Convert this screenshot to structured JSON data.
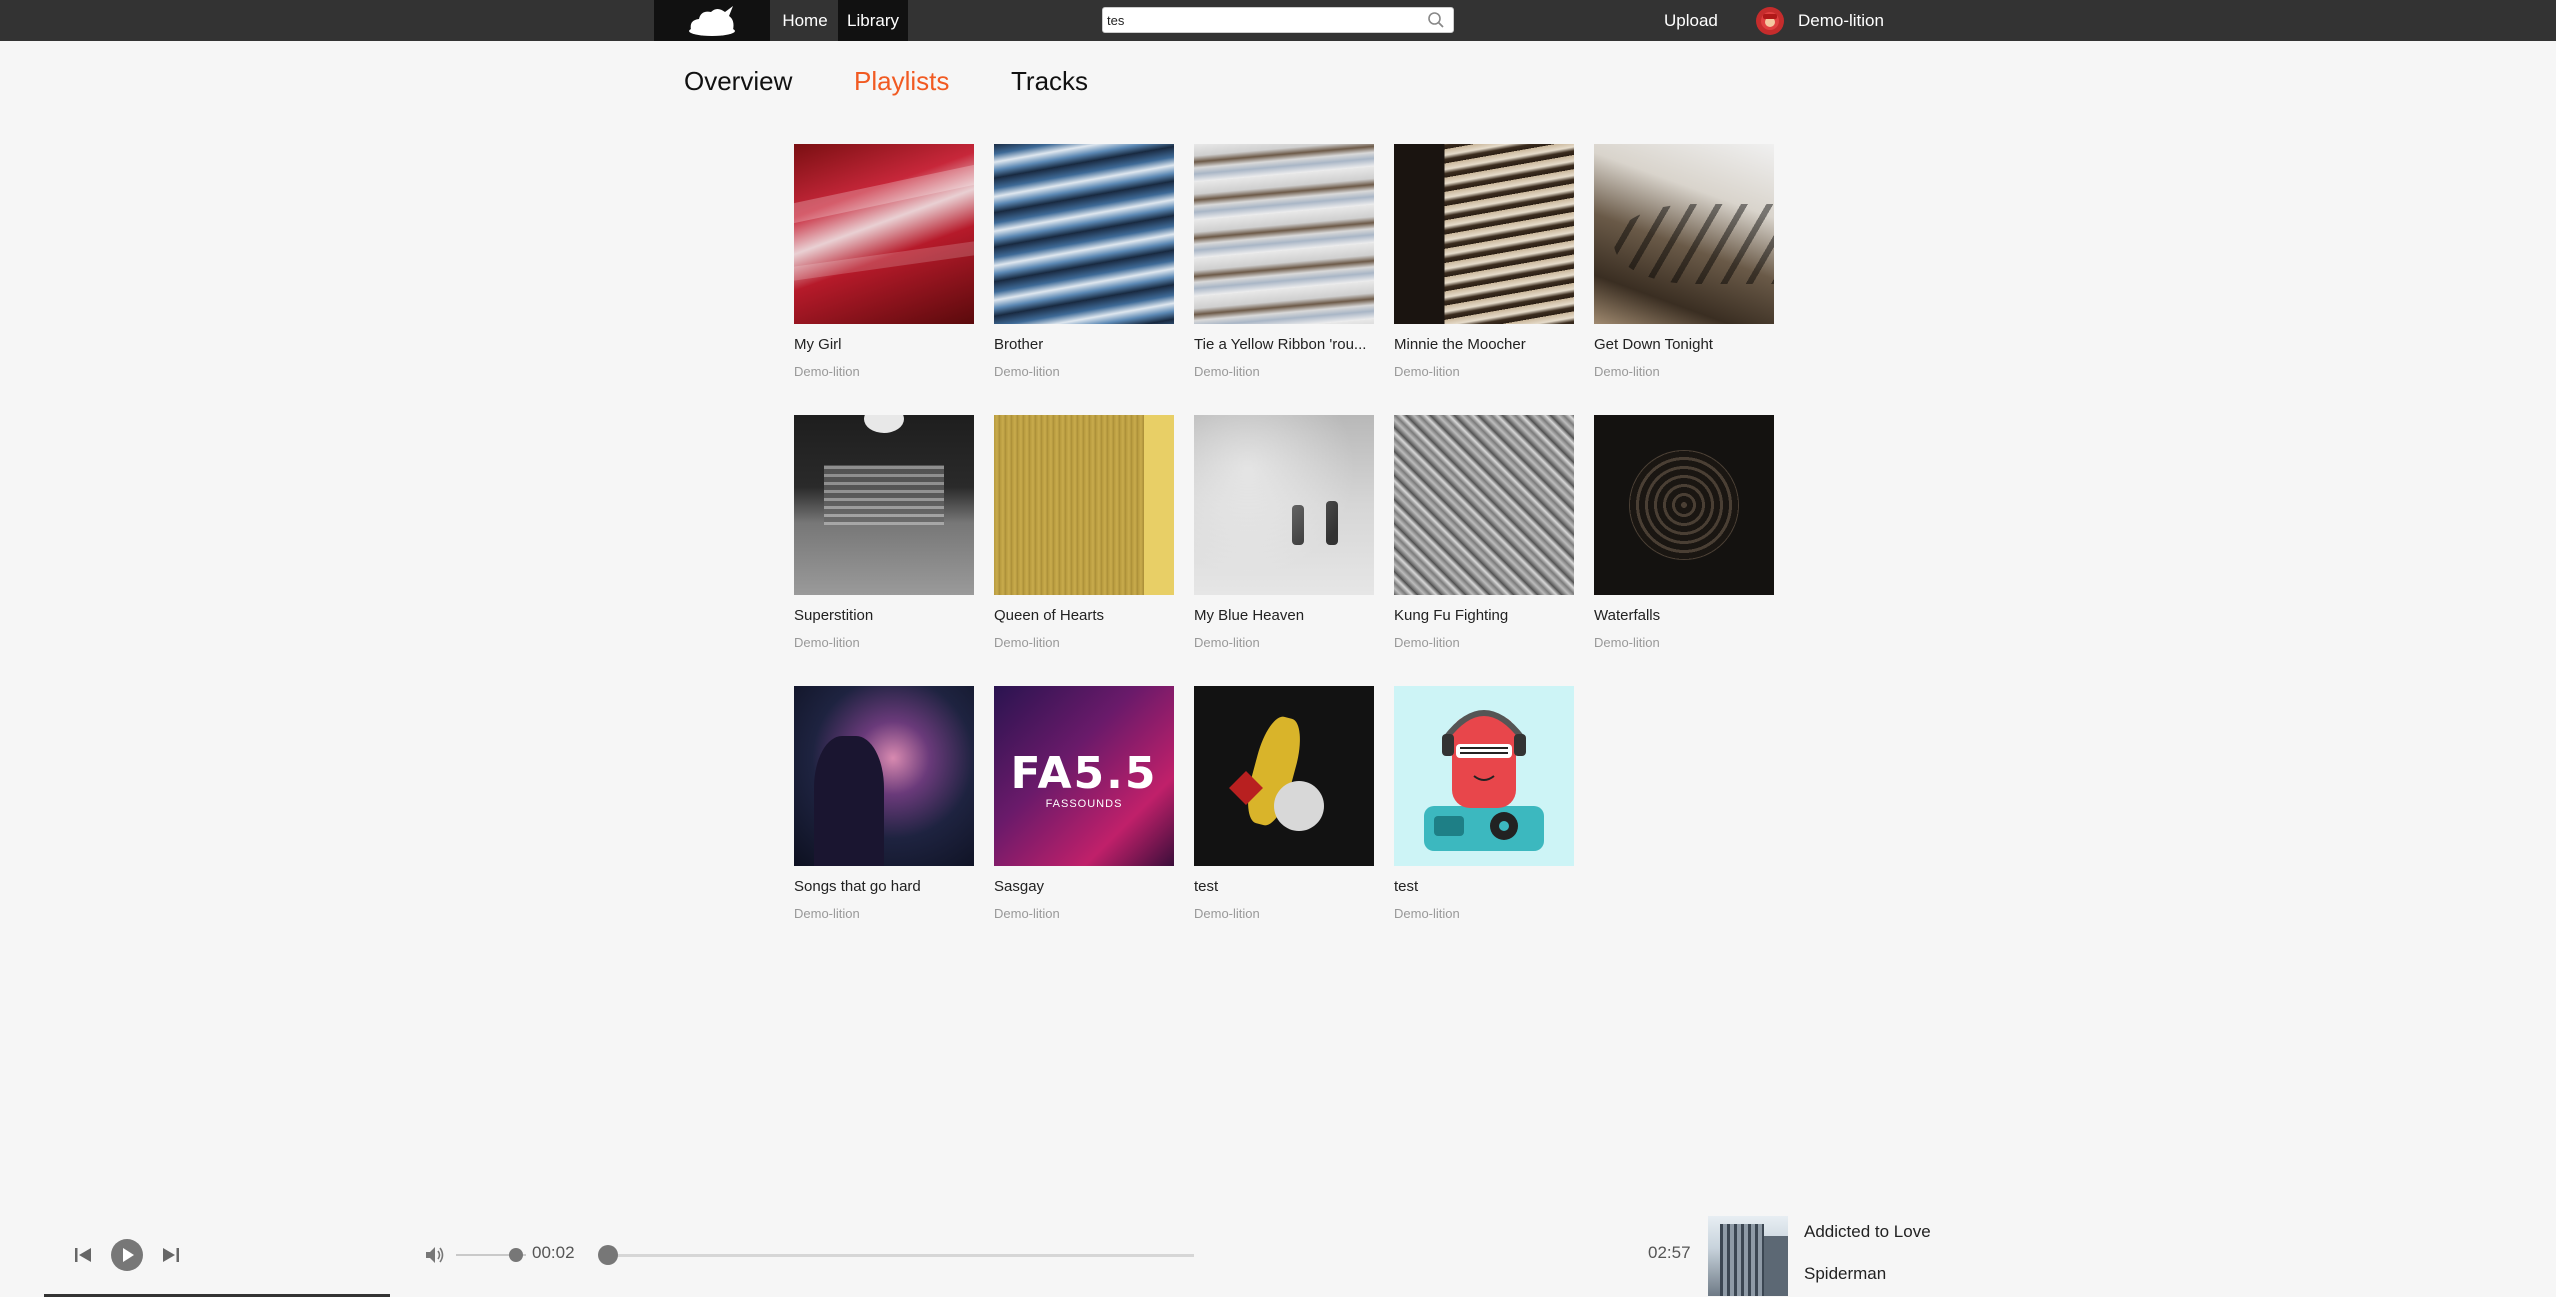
{
  "nav": {
    "home": "Home",
    "library": "Library",
    "search_value": "tes",
    "upload": "Upload",
    "user": "Demo-lition"
  },
  "tabs": [
    "Overview",
    "Playlists",
    "Tracks"
  ],
  "active_tab": "Playlists",
  "playlists": [
    {
      "title": "My Girl",
      "owner": "Demo-lition"
    },
    {
      "title": "Brother",
      "owner": "Demo-lition"
    },
    {
      "title": "Tie a Yellow Ribbon 'rou...",
      "owner": "Demo-lition"
    },
    {
      "title": "Minnie the Moocher",
      "owner": "Demo-lition"
    },
    {
      "title": "Get Down Tonight",
      "owner": "Demo-lition"
    },
    {
      "title": "Superstition",
      "owner": "Demo-lition"
    },
    {
      "title": "Queen of Hearts",
      "owner": "Demo-lition"
    },
    {
      "title": "My Blue Heaven",
      "owner": "Demo-lition"
    },
    {
      "title": "Kung Fu Fighting",
      "owner": "Demo-lition"
    },
    {
      "title": "Waterfalls",
      "owner": "Demo-lition"
    },
    {
      "title": "Songs that go hard",
      "owner": "Demo-lition"
    },
    {
      "title": "Sasgay",
      "owner": "Demo-lition",
      "art_text": "FA5.5",
      "art_subtext": "FASSOUNDS"
    },
    {
      "title": "test",
      "owner": "Demo-lition"
    },
    {
      "title": "test",
      "owner": "Demo-lition"
    }
  ],
  "player": {
    "current_time": "00:02",
    "duration": "02:57",
    "track_title": "Addicted to Love",
    "artist": "Spiderman",
    "progress": 0.01,
    "volume": 0.85
  },
  "colors": {
    "accent": "#f15a22",
    "topbar": "#333333",
    "background": "#f6f6f6"
  }
}
